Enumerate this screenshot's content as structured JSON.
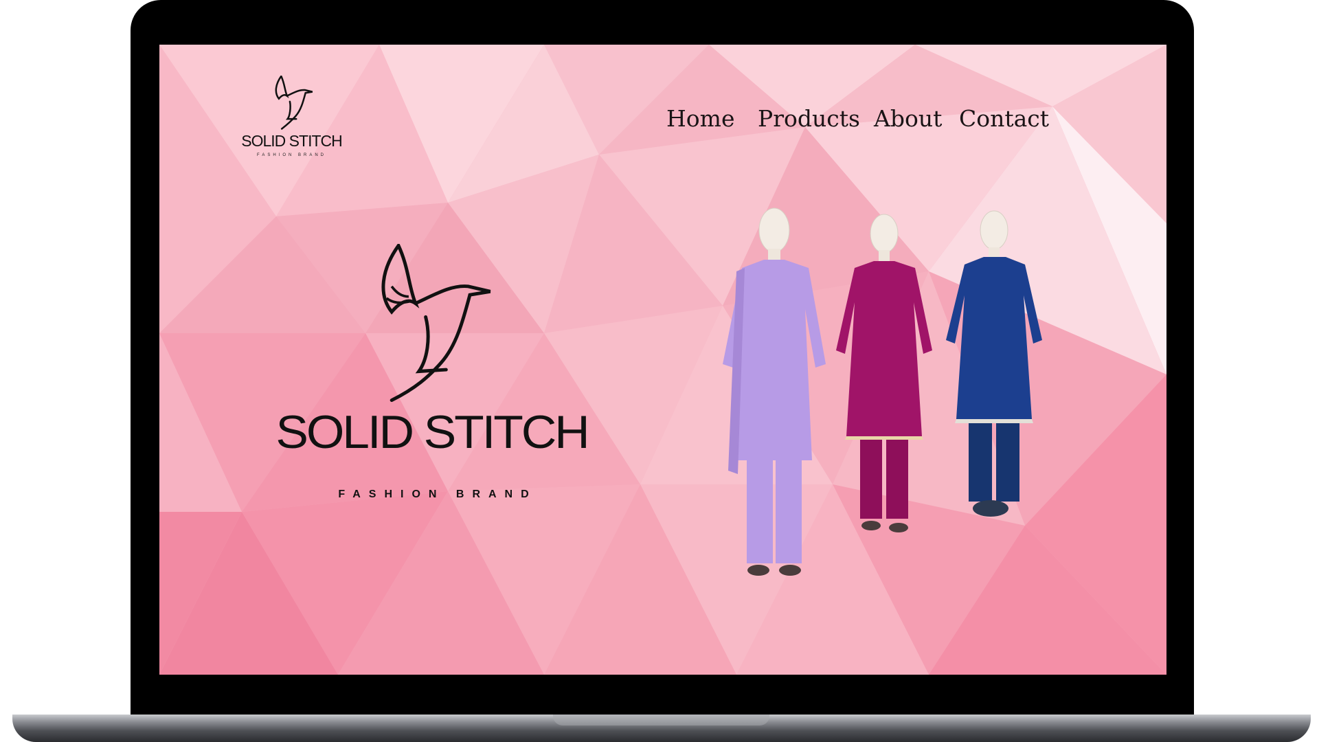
{
  "brand": {
    "name": "SOLID STITCH",
    "tagline": "FASHION BRAND",
    "hero_name": "SOLID STITCH",
    "hero_tagline": "FASHION BRAND"
  },
  "nav": {
    "items": [
      {
        "label": "Home"
      },
      {
        "label": "Products"
      },
      {
        "label": "About"
      },
      {
        "label": "Contact"
      }
    ]
  },
  "products": [
    {
      "color": "#b79be6"
    },
    {
      "color": "#a01468"
    },
    {
      "color": "#1c3f8f"
    }
  ],
  "colors": {
    "background": "#f7b2c2",
    "text": "#111111"
  }
}
